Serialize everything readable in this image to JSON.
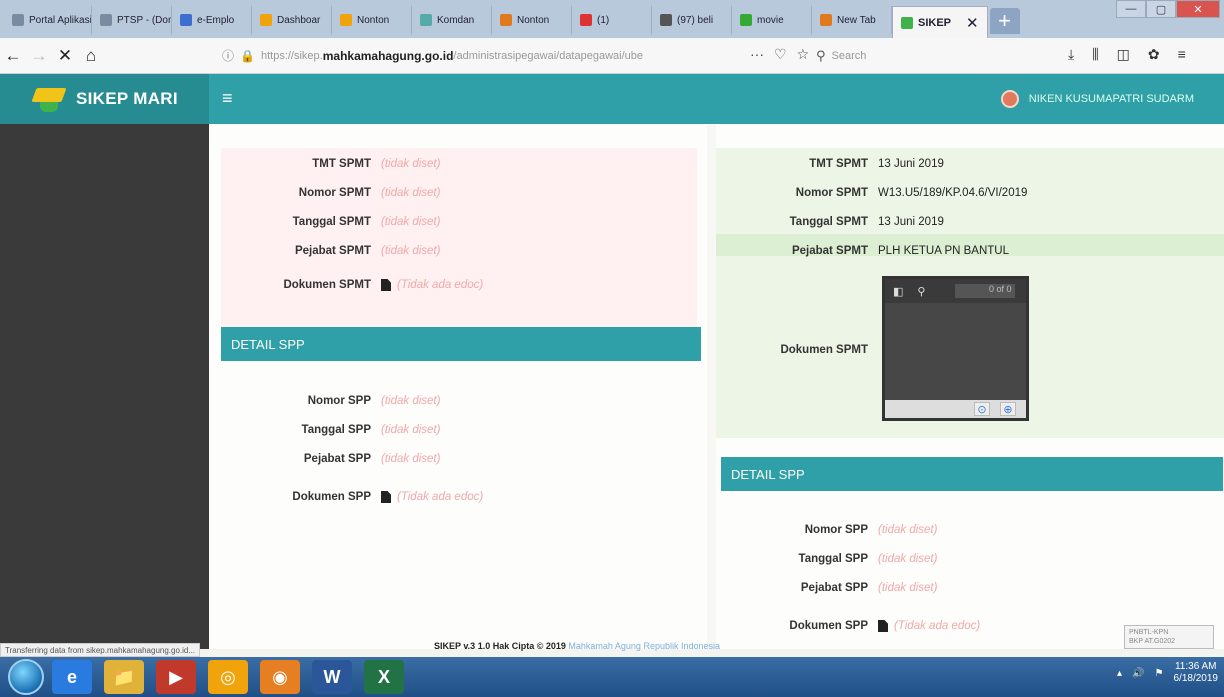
{
  "browser": {
    "tabs": [
      {
        "label": "Portal Aplikasi",
        "color": "#7a8aa0"
      },
      {
        "label": "PTSP - (Dom",
        "color": "#7a8aa0"
      },
      {
        "label": "e-Emplo",
        "color": "#3b6fd1"
      },
      {
        "label": "Dashboar",
        "color": "#f0a30a"
      },
      {
        "label": "Nonton",
        "color": "#f0a30a"
      },
      {
        "label": "Komdan",
        "color": "#5aa"
      },
      {
        "label": "Nonton",
        "color": "#e07a1f"
      },
      {
        "label": "(1)",
        "color": "#d33"
      },
      {
        "label": "(97) beli",
        "color": "#555"
      },
      {
        "label": "movie",
        "color": "#3a3"
      },
      {
        "label": "New Tab",
        "color": "#e07a1f"
      }
    ],
    "active_tab": "SIKEP",
    "url_prefix": "https://sikep.",
    "url_host": "mahkamahagung.go.id",
    "url_path": "/administrasipegawai/datapegawai/ube",
    "search_placeholder": "Search",
    "status_text": "Transferring data from sikep.mahkamahagung.go.id..."
  },
  "app": {
    "brand": "SIKEP MARI",
    "user_name": "NIKEN KUSUMAPATRI SUDARM"
  },
  "left": {
    "spmt": [
      {
        "label": "TMT SPMT",
        "value": "(tidak diset)"
      },
      {
        "label": "Nomor SPMT",
        "value": "(tidak diset)"
      },
      {
        "label": "Tanggal SPMT",
        "value": "(tidak diset)"
      },
      {
        "label": "Pejabat SPMT",
        "value": "(tidak diset)"
      }
    ],
    "doc_label": "Dokumen SPMT",
    "doc_value": "(Tidak ada edoc)",
    "spp_header": "DETAIL SPP",
    "spp": [
      {
        "label": "Nomor SPP",
        "value": "(tidak diset)"
      },
      {
        "label": "Tanggal SPP",
        "value": "(tidak diset)"
      },
      {
        "label": "Pejabat SPP",
        "value": "(tidak diset)"
      }
    ],
    "spp_doc_label": "Dokumen SPP",
    "spp_doc_value": "(Tidak ada edoc)"
  },
  "right": {
    "spmt": [
      {
        "label": "TMT SPMT",
        "value": "13 Juni 2019"
      },
      {
        "label": "Nomor SPMT",
        "value": "W13.U5/189/KP.04.6/VI/2019"
      },
      {
        "label": "Tanggal SPMT",
        "value": "13 Juni 2019"
      },
      {
        "label": "Pejabat SPMT",
        "value": "PLH KETUA PN BANTUL"
      }
    ],
    "doc_label": "Dokumen SPMT",
    "viewer_page": "0 of 0",
    "spp_header": "DETAIL SPP",
    "spp": [
      {
        "label": "Nomor SPP",
        "value": "(tidak diset)"
      },
      {
        "label": "Tanggal SPP",
        "value": "(tidak diset)"
      },
      {
        "label": "Pejabat SPP",
        "value": "(tidak diset)"
      }
    ],
    "spp_doc_label": "Dokumen SPP",
    "spp_doc_value": "(Tidak ada edoc)"
  },
  "footer": {
    "text": "SIKEP v.3 1.0 Hak Cipta © 2019",
    "link": "Mahkamah Agung Republik Indonesia"
  },
  "stamp": {
    "line1": "PNBTL-KPN",
    "line2": "BKP   AT.G0202"
  },
  "taskbar": {
    "apps": [
      "e",
      "📁",
      "▶",
      "◎",
      "◉",
      "W",
      "X"
    ],
    "time": "11:36 AM",
    "date": "6/18/2019"
  }
}
